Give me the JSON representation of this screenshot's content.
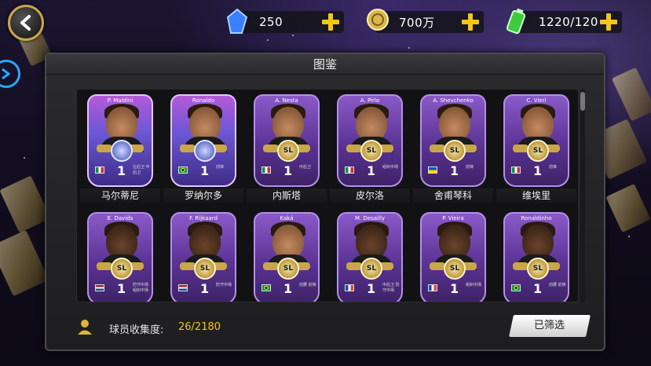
{
  "top_bar": {
    "gems": "250",
    "coins": "700万",
    "stamina": "1220/120"
  },
  "panel": {
    "title": "图鉴"
  },
  "cards": [
    {
      "card_name": "P. Maldini",
      "cn_name": "马尔蒂尼",
      "ovr": "1",
      "position": "左后卫 中后卫",
      "flag": "italy",
      "style": "holo",
      "skin": "light"
    },
    {
      "card_name": "Ronaldo",
      "cn_name": "罗纳尔多",
      "ovr": "1",
      "position": "前锋",
      "flag": "brazil",
      "style": "holo",
      "skin": "light"
    },
    {
      "card_name": "A. Nesta",
      "cn_name": "内斯塔",
      "ovr": "1",
      "position": "中后卫",
      "flag": "italy",
      "style": "sl",
      "skin": "light"
    },
    {
      "card_name": "A. Pirlo",
      "cn_name": "皮尔洛",
      "ovr": "1",
      "position": "组织中场",
      "flag": "italy",
      "style": "sl",
      "skin": "light"
    },
    {
      "card_name": "A. Shevchenko",
      "cn_name": "舍甫琴科",
      "ovr": "1",
      "position": "前锋",
      "flag": "ukraine",
      "style": "sl",
      "skin": "light"
    },
    {
      "card_name": "C. Vieri",
      "cn_name": "维埃里",
      "ovr": "1",
      "position": "前锋",
      "flag": "italy",
      "style": "sl",
      "skin": "light"
    },
    {
      "card_name": "E. Davids",
      "cn_name": "",
      "ovr": "1",
      "position": "防守中场 组织中场",
      "flag": "netherlands",
      "style": "sl",
      "skin": "dark"
    },
    {
      "card_name": "F. Rijkaard",
      "cn_name": "",
      "ovr": "1",
      "position": "防守中场",
      "flag": "netherlands",
      "style": "sl",
      "skin": "dark"
    },
    {
      "card_name": "Kaká",
      "cn_name": "",
      "ovr": "1",
      "position": "前腰 前锋",
      "flag": "brazil",
      "style": "sl",
      "skin": "light"
    },
    {
      "card_name": "M. Desailly",
      "cn_name": "",
      "ovr": "1",
      "position": "中后卫 防守中场",
      "flag": "france",
      "style": "sl",
      "skin": "dark"
    },
    {
      "card_name": "P. Vieira",
      "cn_name": "",
      "ovr": "1",
      "position": "组织中场",
      "flag": "france",
      "style": "sl",
      "skin": "dark"
    },
    {
      "card_name": "Ronaldinho",
      "cn_name": "",
      "ovr": "1",
      "position": "前腰 前锋",
      "flag": "brazil",
      "style": "sl",
      "skin": "dark"
    }
  ],
  "footer": {
    "collection_label": "球员收集度:",
    "collection_value": "26/2180",
    "filter_label": "已筛选"
  },
  "colors": {
    "accent_gold": "#f5c518",
    "card_purple": "#5b3394",
    "panel_bg": "#2b2b2e"
  }
}
